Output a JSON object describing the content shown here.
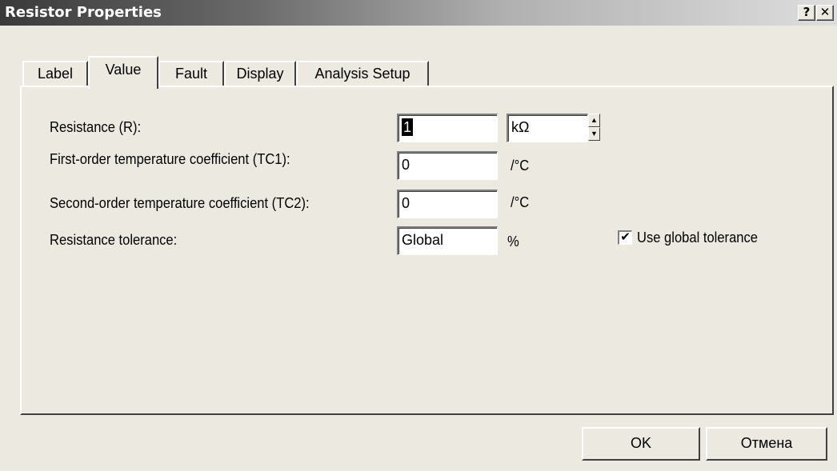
{
  "window": {
    "title": "Resistor Properties",
    "help_label": "?",
    "close_label": "✕"
  },
  "tabs": [
    {
      "label": "Label",
      "active": false
    },
    {
      "label": "Value",
      "active": true
    },
    {
      "label": "Fault",
      "active": false
    },
    {
      "label": "Display",
      "active": false
    },
    {
      "label": "Analysis Setup",
      "active": false
    }
  ],
  "fields": {
    "resistance": {
      "label": "Resistance (R):",
      "value": "1",
      "unit": "kΩ"
    },
    "tc1": {
      "label": "First-order temperature coefficient (TC1):",
      "value": "0",
      "unit": "/°C"
    },
    "tc2": {
      "label": "Second-order temperature coefficient (TC2):",
      "value": "0",
      "unit": "/°C"
    },
    "tolerance": {
      "label": "Resistance tolerance:",
      "value": "Global",
      "unit": "%"
    }
  },
  "global_tolerance": {
    "label": "Use global tolerance",
    "checked": true,
    "check_glyph": "✔"
  },
  "spinner": {
    "up_icon": "▲",
    "down_icon": "▼"
  },
  "buttons": {
    "ok": "OK",
    "cancel": "Отмена"
  }
}
